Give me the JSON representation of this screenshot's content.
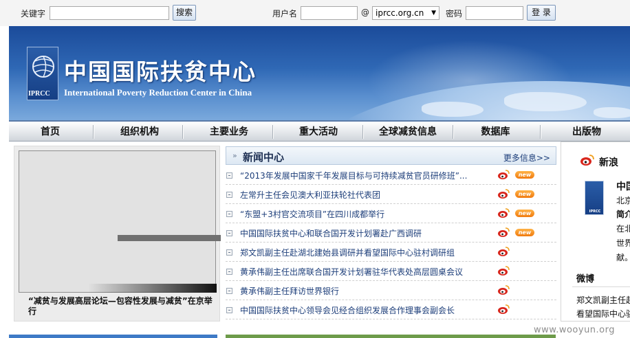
{
  "topbar": {
    "keyword_label": "关键字",
    "keyword_value": "",
    "search_button": "搜索",
    "username_label": "用户名",
    "username_value": "",
    "at_sign": "@",
    "domain_selected": "iprcc.org.cn",
    "password_label": "密码",
    "password_value": "",
    "login_button": "登 录"
  },
  "banner": {
    "logo_abbr": "IPRCC",
    "title": "中国国际扶贫中心",
    "subtitle": "International Poverty Reduction Center in China"
  },
  "nav": {
    "items": [
      "首页",
      "组织机构",
      "主要业务",
      "重大活动",
      "全球减贫信息",
      "数据库",
      "出版物"
    ]
  },
  "photo": {
    "caption": "“减贫与发展高层论坛—包容性发展与减贫”在京举行"
  },
  "news": {
    "title": "新闻中心",
    "more": "更多信息>>",
    "badge_label": "new",
    "items": [
      {
        "text": "“2013年发展中国家千年发展目标与可持续减贫官员研修班”...",
        "new": true
      },
      {
        "text": "左常升主任会见澳大利亚扶轮社代表团",
        "new": true
      },
      {
        "text": "“东盟+3村官交流项目”在四川成都举行",
        "new": true
      },
      {
        "text": "中国国际扶贫中心和联合国开发计划署赴广西调研",
        "new": true
      },
      {
        "text": "郑文凯副主任赴湖北建始县调研并看望国际中心驻村调研组",
        "new": false
      },
      {
        "text": "黄承伟副主任出席联合国开发计划署驻华代表处高层圆桌会议",
        "new": false
      },
      {
        "text": "黄承伟副主任拜访世界银行",
        "new": false
      },
      {
        "text": "中国国际扶贫中心领导会见经合组织发展合作理事会副会长",
        "new": false
      }
    ]
  },
  "weibo": {
    "title": "新浪",
    "card_abbr": "IPRCC",
    "card_lines": [
      "中国",
      "北京",
      "简介",
      "在北",
      "世界",
      "献。"
    ],
    "section_label": "微博",
    "post_lines": [
      "郑文凯副主任赴",
      "看望国际中心驻"
    ]
  },
  "watermark": "www.wooyun.org",
  "colors": {
    "link": "#1d3e7a",
    "banner": "#2f68b5",
    "new_badge": "#f07a0f",
    "weibo_red": "#d8261c"
  }
}
